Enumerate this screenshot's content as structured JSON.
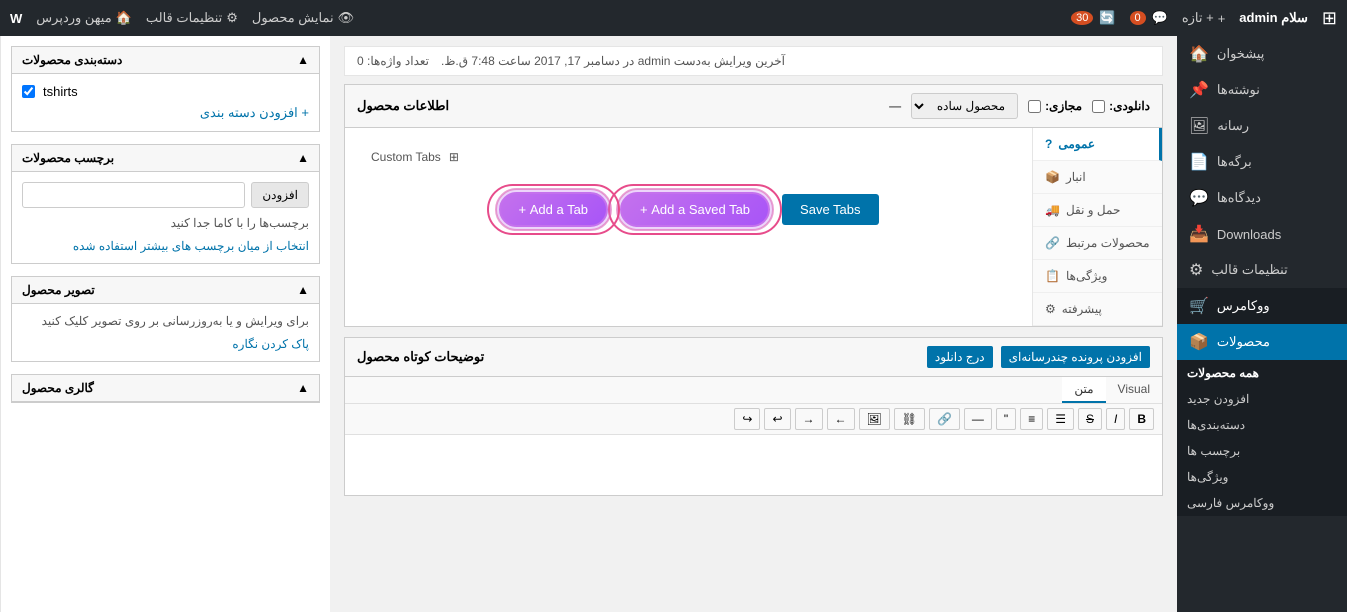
{
  "adminbar": {
    "logo": "W",
    "site_name": "سلام admin",
    "new_label": "+ تازه",
    "comments_count": "0",
    "updates_count": "30",
    "view_site": "نمایش محصول",
    "theme_settings": "تنظیمات قالب",
    "my_account": "میهن وردپرس",
    "gear_icon": "⚙",
    "comment_icon": "💬",
    "update_icon": "🔄",
    "home_icon": "🏠",
    "wp_icon": "W"
  },
  "sidebar": {
    "items": [
      {
        "label": "پیشخوان",
        "icon": "🏠"
      },
      {
        "label": "نوشته‌ها",
        "icon": "📌"
      },
      {
        "label": "رسانه",
        "icon": "🖼"
      },
      {
        "label": "برگه‌ها",
        "icon": "📄"
      },
      {
        "label": "دیدگاه‌ها",
        "icon": "💬"
      },
      {
        "label": "Downloads",
        "icon": "📥"
      },
      {
        "label": "تنظیمات قالب",
        "icon": "⚙"
      },
      {
        "label": "ووکامرس",
        "icon": "🛒"
      },
      {
        "label": "محصولات",
        "icon": "📦",
        "active": true
      }
    ],
    "sub_items": [
      {
        "label": "همه محصولات",
        "active": true
      },
      {
        "label": "افزودن جدید"
      },
      {
        "label": "دسته‌بندی‌ها"
      },
      {
        "label": "برچسب ها"
      },
      {
        "label": "ویژگی‌ها"
      },
      {
        "label": "ووکامرس فارسی"
      }
    ]
  },
  "editor": {
    "last_edit": "آخرین ویرایش به‌دست admin در دسامبر 17, 2017 ساعت 7:48 ق.ظ.",
    "word_count_label": "تعداد واژه‌ها: 0"
  },
  "product_data": {
    "title": "اطلاعات محصول",
    "product_type": "محصول ساده",
    "virtual_label": "مجازی:",
    "download_label": "دانلودی:",
    "tabs": [
      {
        "label": "عمومی",
        "icon": "?",
        "active": true
      },
      {
        "label": "انبار",
        "icon": "📦"
      },
      {
        "label": "حمل و نقل",
        "icon": "🚚"
      },
      {
        "label": "محصولات مرتبط",
        "icon": "🔗"
      },
      {
        "label": "ویژگی‌ها",
        "icon": "📋"
      },
      {
        "label": "پیشرفته",
        "icon": "⚙"
      }
    ],
    "custom_tabs_label": "Custom Tabs",
    "save_tabs_btn": "Save Tabs",
    "add_saved_tab_btn": "Add a Saved Tab +",
    "add_tab_btn": "Add a Tab +"
  },
  "short_desc": {
    "title": "توضیحات کوتاه محصول",
    "tab_text": "متن",
    "tab_visual": "Visual",
    "insert_btn": "افزودن پرونده چندرسانه‌ای",
    "download_btn": "درج دانلود",
    "toolbar_icons": [
      "b",
      "i",
      "link",
      "ul",
      "ol",
      "blockquote",
      "img",
      "hr",
      "indent-left",
      "indent-right",
      "undo",
      "redo",
      "remove-format",
      "special-char"
    ]
  },
  "meta_sidebar": {
    "category_title": "دسته‌بندی محصولات",
    "tshirts_label": "tshirts",
    "add_category": "+ افزودن دسته بندی",
    "tags_title": "برچسب محصولات",
    "tags_input_placeholder": "",
    "add_btn": "افزودن",
    "tags_desc": "برچسب‌ها را با کاما جدا کنید",
    "tags_link": "انتخاب از میان برچسب های بیشتر استفاده شده",
    "image_title": "تصویر محصول",
    "image_desc": "برای ویرایش و یا به‌روزرسانی بر روی تصویر کلیک کنید",
    "image_clear": "پاک کردن نگاره",
    "gallery_title": "گالری محصول"
  },
  "colors": {
    "primary": "#0073aa",
    "adminbar_bg": "#23282d",
    "sidebar_bg": "#23282d",
    "sidebar_active": "#0073aa",
    "sidebar_sub_bg": "#191e23",
    "button_purple": "#9b59b6",
    "highlight_circle": "#e74c8b"
  }
}
